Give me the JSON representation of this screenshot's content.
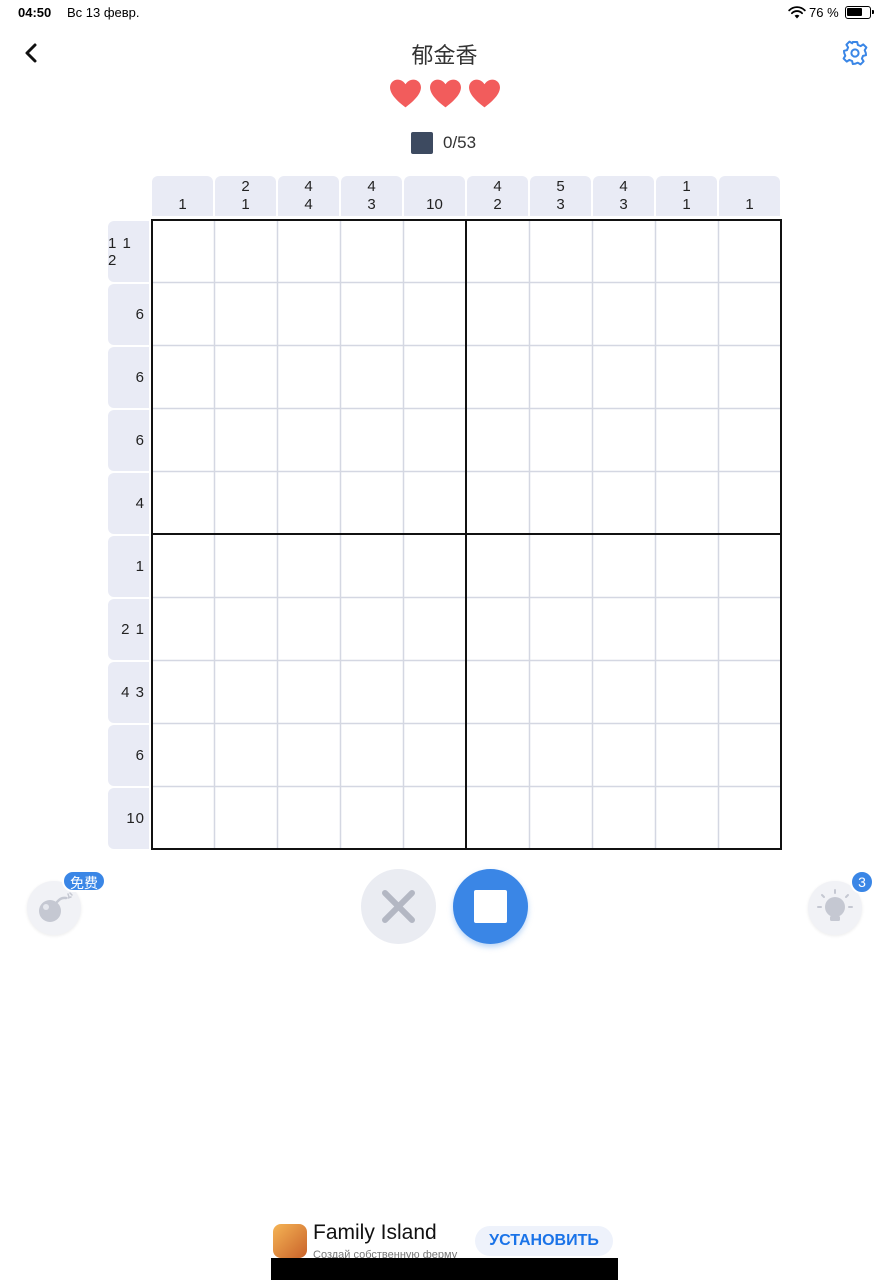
{
  "status_bar": {
    "time": "04:50",
    "date": "Вс 13 февр.",
    "battery_percent": "76 %",
    "battery_level": 0.76
  },
  "header": {
    "title": "郁金香",
    "back_icon": "chevron-left-icon",
    "settings_icon": "gear-icon"
  },
  "lives": {
    "count": 3,
    "icon": "heart-icon",
    "color": "#f25c5c"
  },
  "progress": {
    "text": "0/53",
    "swatch_color": "#3d4a60"
  },
  "column_clues": [
    [
      "1"
    ],
    [
      "2",
      "1"
    ],
    [
      "4",
      "4"
    ],
    [
      "4",
      "3"
    ],
    [
      "10"
    ],
    [
      "4",
      "2"
    ],
    [
      "5",
      "3"
    ],
    [
      "4",
      "3"
    ],
    [
      "1",
      "1"
    ],
    [
      "1"
    ]
  ],
  "row_clues": [
    "1 1 2",
    "6",
    "6",
    "6",
    "4",
    "1",
    "2 1",
    "4 3",
    "6",
    "10"
  ],
  "controls": {
    "bomb_badge": "免费",
    "hint_count": "3",
    "accent": "#3a86e6"
  },
  "ad": {
    "title": "Family Island",
    "subtitle": "Создай собственную ферму",
    "install_label": "УСТАНОВИТЬ"
  }
}
